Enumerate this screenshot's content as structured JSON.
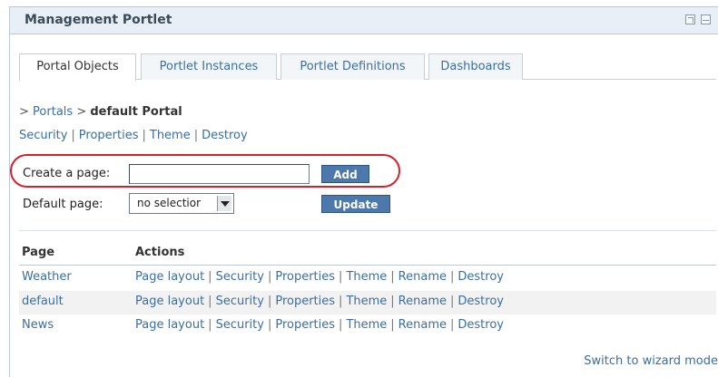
{
  "portlet": {
    "title": "Management Portlet",
    "icons": [
      "maximize-icon",
      "minimize-icon"
    ]
  },
  "tabs": [
    {
      "label": "Portal Objects",
      "active": true
    },
    {
      "label": "Portlet Instances",
      "active": false
    },
    {
      "label": "Portlet Definitions",
      "active": false
    },
    {
      "label": "Dashboards",
      "active": false
    }
  ],
  "breadcrumb": {
    "prefix1": ">",
    "portals": "Portals",
    "prefix2": ">",
    "current": "default Portal"
  },
  "portal_links": [
    "Security",
    "Properties",
    "Theme",
    "Destroy"
  ],
  "separator": "|",
  "create_page": {
    "label": "Create a page:",
    "value": "",
    "button": "Add"
  },
  "default_page": {
    "label": "Default page:",
    "selected": "no selectior",
    "button": "Update"
  },
  "table": {
    "headers": {
      "page": "Page",
      "actions": "Actions"
    },
    "rows": [
      {
        "page": "Weather",
        "actions": [
          "Page layout",
          "Security",
          "Properties",
          "Theme",
          "Rename",
          "Destroy"
        ]
      },
      {
        "page": "default",
        "actions": [
          "Page layout",
          "Security",
          "Properties",
          "Theme",
          "Rename",
          "Destroy"
        ]
      },
      {
        "page": "News",
        "actions": [
          "Page layout",
          "Security",
          "Properties",
          "Theme",
          "Rename",
          "Destroy"
        ]
      }
    ]
  },
  "wizard_link": "Switch to wizard mode",
  "colors": {
    "link": "#3a6ea5",
    "button": "#4d78ab",
    "highlight": "#d6202a",
    "titlebar": "#e9eff6"
  }
}
